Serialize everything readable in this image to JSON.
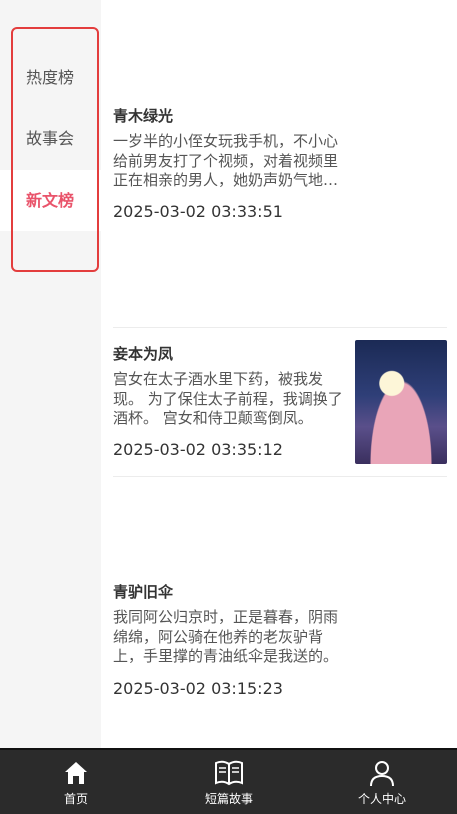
{
  "sidebar": {
    "items": [
      {
        "label": "热度榜"
      },
      {
        "label": "故事会"
      },
      {
        "label": "新文榜"
      }
    ],
    "active_index": 2
  },
  "articles": [
    {
      "title": "青木绿光",
      "summary": "一岁半的小侄女玩我手机，不小心给前男友打了个视频，对着视频里正在相亲的男人，她奶声奶气地喊了一声爸爸。",
      "date": "2025-03-02 03:33:51"
    },
    {
      "title": "妾本为凤",
      "summary": "宫女在太子酒水里下药，被我发现。 为了保住太子前程，我调换了酒杯。 宫女和侍卫颠鸾倒凤。",
      "date": "2025-03-02 03:35:12"
    },
    {
      "title": "青驴旧伞",
      "summary": "我同阿公归京时，正是暮春，阴雨绵绵，阿公骑在他养的老灰驴背上，手里撑的青油纸伞是我送的。",
      "date": "2025-03-02 03:15:23"
    }
  ],
  "tabbar": {
    "items": [
      {
        "label": "首页",
        "icon": "home-icon"
      },
      {
        "label": "短篇故事",
        "icon": "book-icon"
      },
      {
        "label": "个人中心",
        "icon": "user-icon"
      }
    ]
  },
  "colors": {
    "accent": "#e9546b",
    "highlight_border": "#e33d3d",
    "sidebar_bg": "#f5f5f5",
    "tabbar_bg": "#2b2b2b"
  }
}
